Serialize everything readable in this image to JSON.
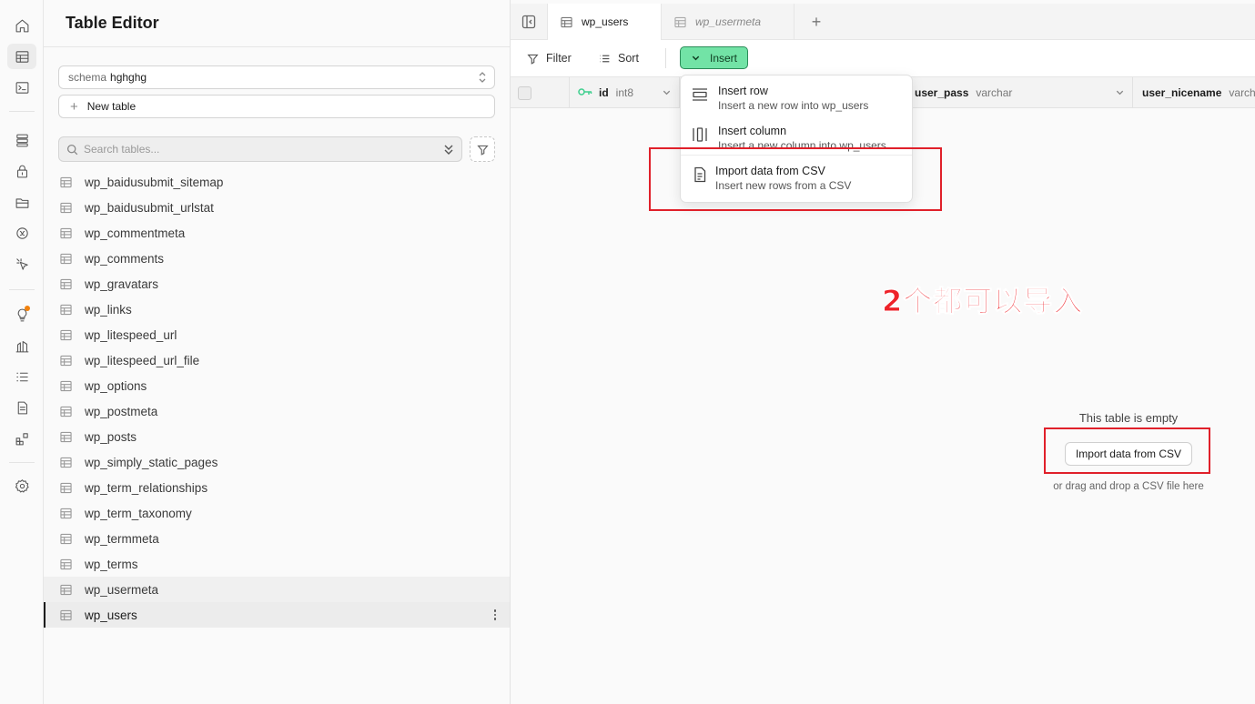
{
  "sidebar": {
    "title": "Table Editor",
    "schema_label": "schema",
    "schema_value": "hghghg",
    "new_table_label": "New table",
    "search_placeholder": "Search tables...",
    "tables": [
      "wp_baidusubmit_sitemap",
      "wp_baidusubmit_urlstat",
      "wp_commentmeta",
      "wp_comments",
      "wp_gravatars",
      "wp_links",
      "wp_litespeed_url",
      "wp_litespeed_url_file",
      "wp_options",
      "wp_postmeta",
      "wp_posts",
      "wp_simply_static_pages",
      "wp_term_relationships",
      "wp_term_taxonomy",
      "wp_termmeta",
      "wp_terms",
      "wp_usermeta",
      "wp_users"
    ],
    "selected_table": "wp_users",
    "hovered_table": "wp_usermeta"
  },
  "tabs": [
    {
      "label": "wp_users",
      "active": true
    },
    {
      "label": "wp_usermeta",
      "active": false
    }
  ],
  "toolbar": {
    "filter_label": "Filter",
    "sort_label": "Sort",
    "insert_label": "Insert"
  },
  "columns": [
    {
      "name": "id",
      "type": "int8",
      "primary_key": true
    },
    {
      "name": "user_pass",
      "type": "varchar"
    },
    {
      "name": "user_nicename",
      "type": "varchar"
    }
  ],
  "insert_menu": {
    "items": [
      {
        "label": "Insert row",
        "description": "Insert a new row into wp_users",
        "icon": "rows-icon"
      },
      {
        "label": "Insert column",
        "description": "Insert a new column into wp_users",
        "icon": "columns-icon"
      },
      {
        "label": "Import data from CSV",
        "description": "Insert new rows from a CSV",
        "icon": "file-text-icon"
      }
    ]
  },
  "empty_state": {
    "title": "This table is empty",
    "button_label": "Import data from CSV",
    "hint": "or drag and drop a CSV file here"
  },
  "annotation": {
    "text": "2个都可以导入",
    "color": "#e0202a"
  },
  "colors": {
    "accent_green": "#72e3a6",
    "accent_green_border": "#2c8c59",
    "key_green": "#3ecf8e",
    "notification_dot": "#f1810c"
  }
}
